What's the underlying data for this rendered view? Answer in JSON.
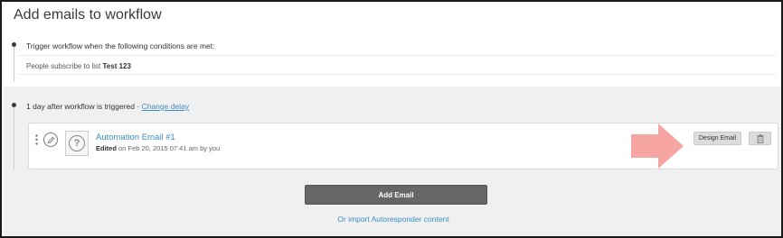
{
  "page": {
    "title": "Add emails to workflow"
  },
  "trigger": {
    "label": "Trigger workflow when the following conditions are met:",
    "condition_prefix": "People subscribe to list",
    "condition_list": "Test 123"
  },
  "delay": {
    "label": "1 day after workflow is triggered",
    "separator": "·",
    "change_link": "Change delay"
  },
  "email": {
    "name": "Automation Email #1",
    "meta_prefix": "Edited",
    "meta_suffix": "on Feb 20, 2015 07:41 am by you",
    "design_button": "Design Email",
    "thumbnail_icon": "question-mark-icon"
  },
  "actions": {
    "add_email": "Add Email",
    "import_link": "Or import Autoresponder content"
  },
  "colors": {
    "link": "#3b8ec4",
    "section_bg": "#f0f0f0",
    "add_button": "#666666",
    "arrow": "#f6a5a3"
  }
}
